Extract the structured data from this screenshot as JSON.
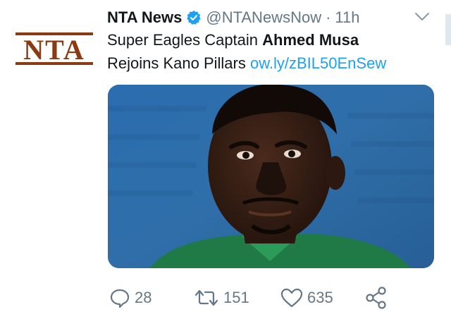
{
  "author": {
    "name": "NTA News",
    "handle": "@NTANewsNow",
    "separator": "·",
    "time": "11h",
    "avatar_text": "NTA"
  },
  "tweet": {
    "text_part1": "Super Eagles Captain ",
    "text_bold": "Ahmed Musa",
    "text_part2": "Rejoins Kano Pillars ",
    "link": "ow.ly/zBIL50EnSew"
  },
  "actions": {
    "reply_count": "28",
    "retweet_count": "151",
    "like_count": "635"
  },
  "colors": {
    "link": "#1da1f2",
    "muted": "#657786",
    "verified": "#1da1f2",
    "brand": "#8b3a12"
  }
}
